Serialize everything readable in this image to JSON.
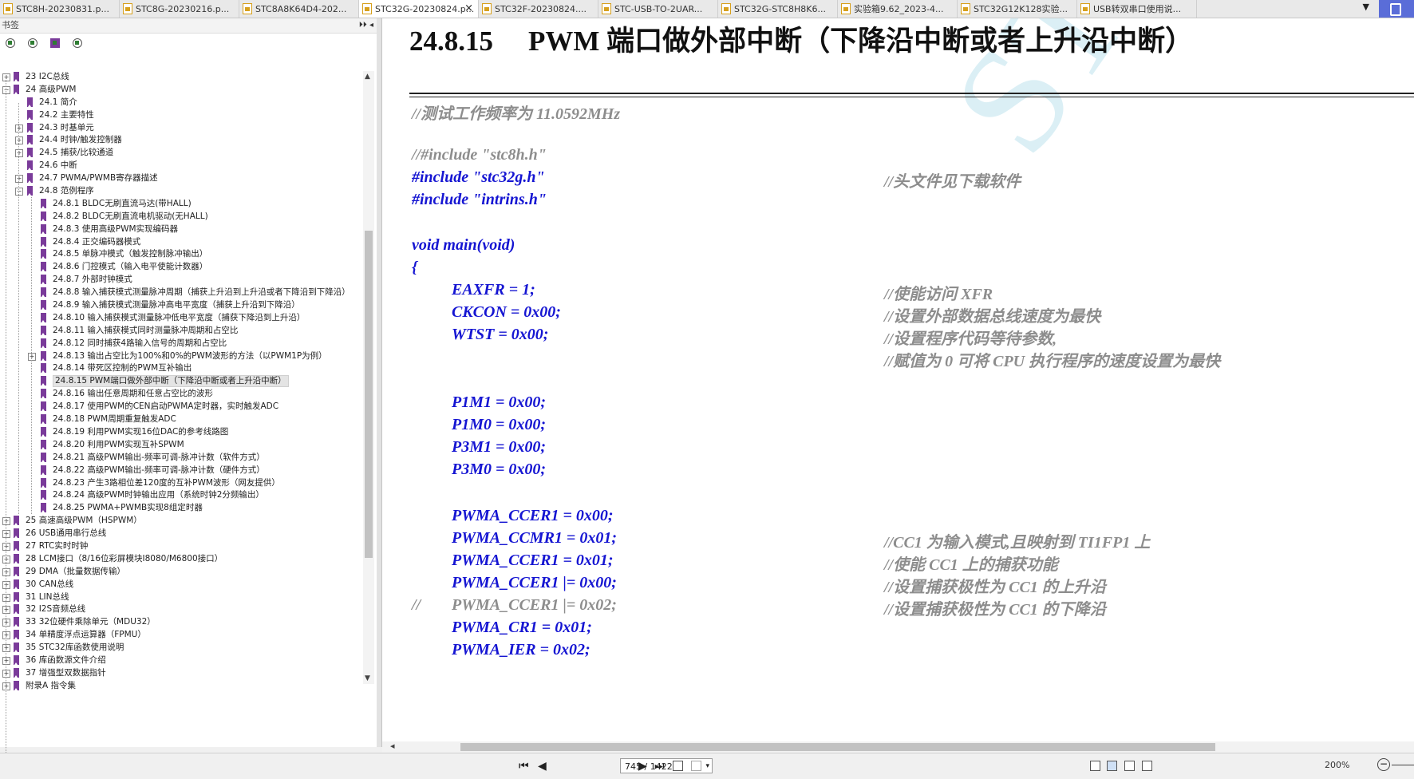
{
  "tabs": [
    {
      "title": "STC8H-20230831.p...",
      "active": false
    },
    {
      "title": "STC8G-20230216.p...",
      "active": false
    },
    {
      "title": "STC8A8K64D4-202...",
      "active": false
    },
    {
      "title": "STC32G-20230824.p...",
      "active": true
    },
    {
      "title": "STC32F-20230824....",
      "active": false
    },
    {
      "title": "STC-USB-TO-2UAR...",
      "active": false
    },
    {
      "title": "STC32G-STC8H8K6...",
      "active": false
    },
    {
      "title": "实验箱9.62_2023-4...",
      "active": false
    },
    {
      "title": "STC32G12K128实验...",
      "active": false
    },
    {
      "title": "USB转双串口使用说...",
      "active": false
    }
  ],
  "tab_close": "×",
  "tab_menu": "▼",
  "sidebar": {
    "title": "书签",
    "header_buttons": "⏵⏵ ◂",
    "bookmarks": [
      {
        "label": "23  I2C总线",
        "level": 0,
        "exp": "+"
      },
      {
        "label": "24  高级PWM",
        "level": 0,
        "exp": "-"
      },
      {
        "label": "24.1 简介",
        "level": 1,
        "exp": ""
      },
      {
        "label": "24.2 主要特性",
        "level": 1,
        "exp": ""
      },
      {
        "label": "24.3 时基单元",
        "level": 1,
        "exp": "+"
      },
      {
        "label": "24.4 时钟/触发控制器",
        "level": 1,
        "exp": "+"
      },
      {
        "label": "24.5 捕获/比较通道",
        "level": 1,
        "exp": "+"
      },
      {
        "label": "24.6 中断",
        "level": 1,
        "exp": ""
      },
      {
        "label": "24.7  PWMA/PWMB寄存器描述",
        "level": 1,
        "exp": "+"
      },
      {
        "label": "24.8  范例程序",
        "level": 1,
        "exp": "-"
      },
      {
        "label": "24.8.1 BLDC无刷直流马达(带HALL)",
        "level": 2,
        "exp": ""
      },
      {
        "label": "24.8.2  BLDC无刷直流电机驱动(无HALL)",
        "level": 2,
        "exp": ""
      },
      {
        "label": "24.8.3 使用高级PWM实现编码器",
        "level": 2,
        "exp": ""
      },
      {
        "label": "24.8.4 正交编码器模式",
        "level": 2,
        "exp": ""
      },
      {
        "label": "24.8.5 单脉冲模式（触发控制脉冲输出）",
        "level": 2,
        "exp": ""
      },
      {
        "label": "24.8.6 门控模式（输入电平使能计数器）",
        "level": 2,
        "exp": ""
      },
      {
        "label": "24.8.7 外部时钟模式",
        "level": 2,
        "exp": ""
      },
      {
        "label": "24.8.8  输入捕获模式测量脉冲周期（捕获上升沿到上升沿或者下降沿到下降沿）",
        "level": 2,
        "exp": ""
      },
      {
        "label": "24.8.9  输入捕获模式测量脉冲高电平宽度（捕获上升沿到下降沿）",
        "level": 2,
        "exp": ""
      },
      {
        "label": "24.8.10  输入捕获模式测量脉冲低电平宽度（捕获下降沿到上升沿）",
        "level": 2,
        "exp": ""
      },
      {
        "label": "24.8.11  输入捕获模式同时测量脉冲周期和占空比",
        "level": 2,
        "exp": ""
      },
      {
        "label": "24.8.12  同时捕获4路输入信号的周期和占空比",
        "level": 2,
        "exp": ""
      },
      {
        "label": "24.8.13  输出占空比为100%和0%的PWM波形的方法（以PWM1P为例）",
        "level": 2,
        "exp": "+"
      },
      {
        "label": "24.8.14 带死区控制的PWM互补输出",
        "level": 2,
        "exp": ""
      },
      {
        "label": "24.8.15 PWM端口做外部中断（下降沿中断或者上升沿中断）",
        "level": 2,
        "exp": "",
        "selected": true
      },
      {
        "label": "24.8.16 输出任意周期和任意占空比的波形",
        "level": 2,
        "exp": ""
      },
      {
        "label": "24.8.17 使用PWM的CEN启动PWMA定时器，实时触发ADC",
        "level": 2,
        "exp": ""
      },
      {
        "label": "24.8.18 PWM周期重复触发ADC",
        "level": 2,
        "exp": ""
      },
      {
        "label": "24.8.19 利用PWM实现16位DAC的参考线路图",
        "level": 2,
        "exp": ""
      },
      {
        "label": "24.8.20 利用PWM实现互补SPWM",
        "level": 2,
        "exp": ""
      },
      {
        "label": "24.8.21 高级PWM输出-频率可调-脉冲计数（软件方式）",
        "level": 2,
        "exp": ""
      },
      {
        "label": "24.8.22 高级PWM输出-频率可调-脉冲计数（硬件方式）",
        "level": 2,
        "exp": ""
      },
      {
        "label": "24.8.23  产生3路相位差120度的互补PWM波形（网友提供）",
        "level": 2,
        "exp": ""
      },
      {
        "label": "24.8.24 高级PWM时钟输出应用（系统时钟2分频输出）",
        "level": 2,
        "exp": ""
      },
      {
        "label": "24.8.25 PWMA+PWMB实现8组定时器",
        "level": 2,
        "exp": ""
      },
      {
        "label": "25  高速高级PWM（HSPWM）",
        "level": 0,
        "exp": "+"
      },
      {
        "label": "26  USB通用串行总线",
        "level": 0,
        "exp": "+"
      },
      {
        "label": "27  RTC实时时钟",
        "level": 0,
        "exp": "+"
      },
      {
        "label": "28  LCM接口（8/16位彩屏模块I8080/M6800接口）",
        "level": 0,
        "exp": "+"
      },
      {
        "label": "29  DMA（批量数据传输）",
        "level": 0,
        "exp": "+"
      },
      {
        "label": "30  CAN总线",
        "level": 0,
        "exp": "+"
      },
      {
        "label": "31  LIN总线",
        "level": 0,
        "exp": "+"
      },
      {
        "label": "32  I2S音频总线",
        "level": 0,
        "exp": "+"
      },
      {
        "label": "33  32位硬件乘除单元（MDU32）",
        "level": 0,
        "exp": "+"
      },
      {
        "label": "34  单精度浮点运算器（FPMU）",
        "level": 0,
        "exp": "+"
      },
      {
        "label": "35  STC32库函数使用说明",
        "level": 0,
        "exp": "+"
      },
      {
        "label": "36  库函数源文件介绍",
        "level": 0,
        "exp": "+"
      },
      {
        "label": "37  增强型双数据指针",
        "level": 0,
        "exp": "+"
      },
      {
        "label": "附录A  指令集",
        "level": 0,
        "exp": "+"
      }
    ]
  },
  "document": {
    "watermark": "STC MCU",
    "heading_number": "24.8.15",
    "heading_title": "PWM 端口做外部中断（下降沿中断或者上升沿中断）",
    "code_lines": [
      {
        "left": "//测试工作频率为 11.0592MHz",
        "indent": 0,
        "gray": true,
        "comment": ""
      },
      {
        "left": "//#include \"stc8h.h\"",
        "indent": 0,
        "gray": true,
        "comment": ""
      },
      {
        "left": "#include \"stc32g.h\"",
        "indent": 0,
        "gray": false,
        "comment": "//头文件见下载软件"
      },
      {
        "left": "#include \"intrins.h\"",
        "indent": 0,
        "gray": false,
        "comment": ""
      },
      {
        "left": "void main(void)",
        "indent": 0,
        "gray": false,
        "comment": ""
      },
      {
        "left": "{",
        "indent": 0,
        "gray": false,
        "comment": ""
      },
      {
        "left": "EAXFR = 1;",
        "indent": 1,
        "gray": false,
        "comment": "//使能访问 XFR"
      },
      {
        "left": "CKCON = 0x00;",
        "indent": 1,
        "gray": false,
        "comment": "//设置外部数据总线速度为最快"
      },
      {
        "left": "WTST = 0x00;",
        "indent": 1,
        "gray": false,
        "comment": "//设置程序代码等待参数,"
      },
      {
        "left": "",
        "indent": 1,
        "gray": false,
        "comment": "//赋值为 0 可将 CPU 执行程序的速度设置为最快"
      },
      {
        "left": "P1M1 = 0x00;",
        "indent": 1,
        "gray": false,
        "comment": ""
      },
      {
        "left": "P1M0 = 0x00;",
        "indent": 1,
        "gray": false,
        "comment": ""
      },
      {
        "left": "P3M1 = 0x00;",
        "indent": 1,
        "gray": false,
        "comment": ""
      },
      {
        "left": "P3M0 = 0x00;",
        "indent": 1,
        "gray": false,
        "comment": ""
      },
      {
        "left": "PWMA_CCER1 = 0x00;",
        "indent": 1,
        "gray": false,
        "comment": ""
      },
      {
        "left": "PWMA_CCMR1 = 0x01;",
        "indent": 1,
        "gray": false,
        "comment": "//CC1 为输入模式,且映射到 TI1FP1 上"
      },
      {
        "left": "PWMA_CCER1 = 0x01;",
        "indent": 1,
        "gray": false,
        "comment": "//使能 CC1 上的捕获功能"
      },
      {
        "left": "PWMA_CCER1 |= 0x00;",
        "indent": 1,
        "gray": false,
        "comment": "//设置捕获极性为 CC1 的上升沿"
      },
      {
        "left": "PWMA_CCER1 |= 0x02;",
        "indent": 1,
        "gray": true,
        "prefix": "//",
        "comment": "//设置捕获极性为 CC1 的下降沿"
      },
      {
        "left": "PWMA_CR1 = 0x01;",
        "indent": 1,
        "gray": false,
        "comment": ""
      },
      {
        "left": "PWMA_IER = 0x02;",
        "indent": 1,
        "gray": false,
        "comment": ""
      }
    ]
  },
  "statusbar": {
    "page_indicator": "745 / 1422",
    "zoom": "200%",
    "first": "⏮",
    "prev": "◀",
    "next": "▶",
    "last": "⏭",
    "dropdown": "▾",
    "zoom_out": "−"
  }
}
